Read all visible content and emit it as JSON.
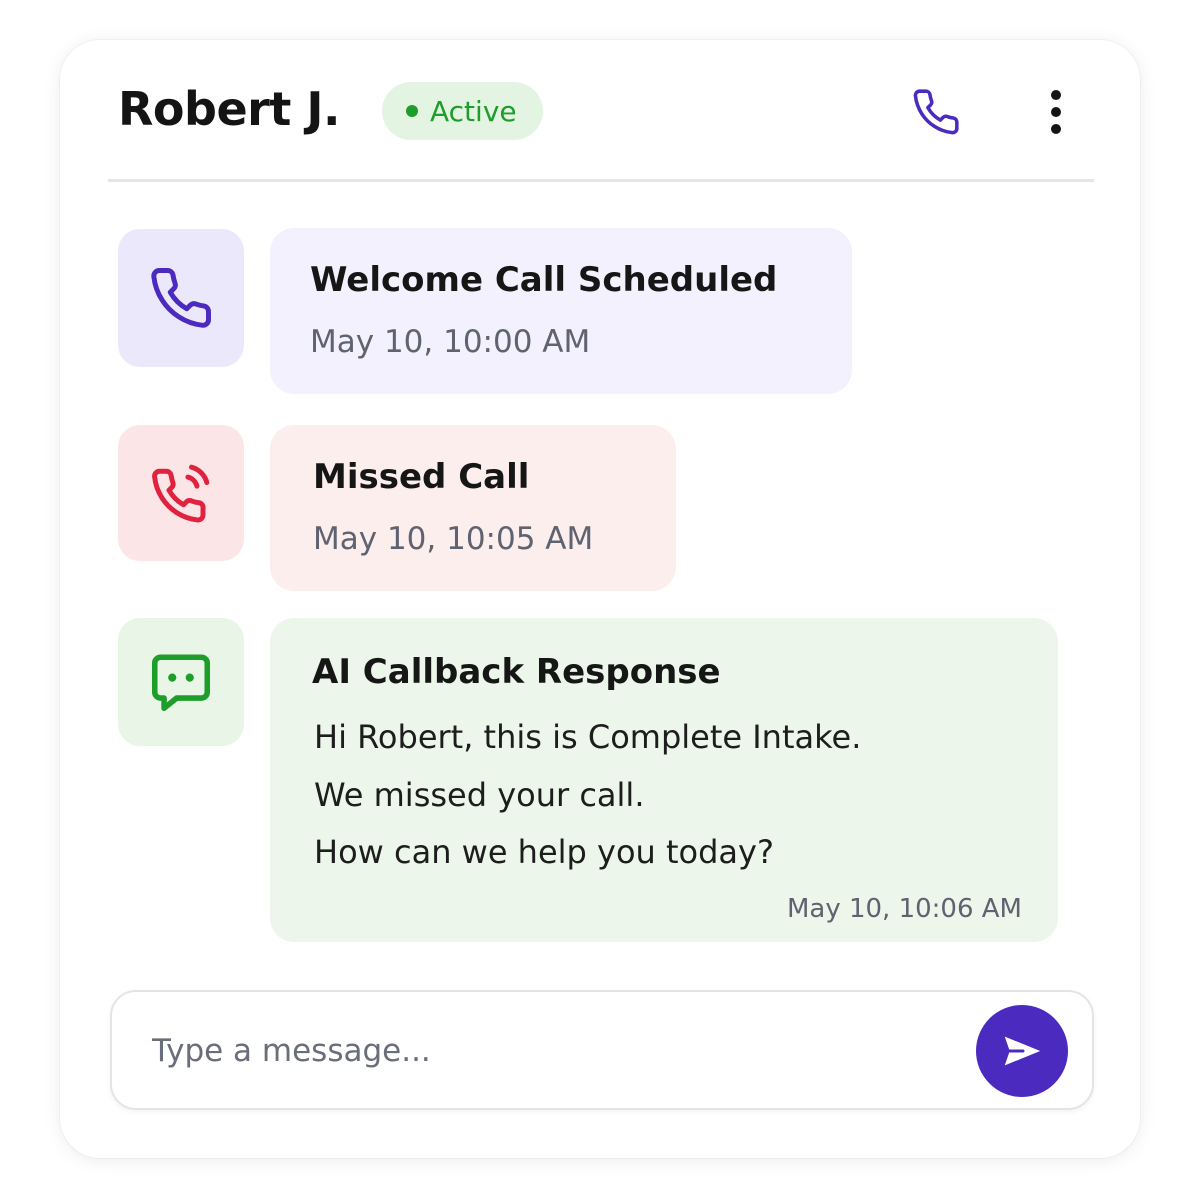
{
  "header": {
    "contact_name": "Robert J.",
    "status": "Active",
    "icons": {
      "call": "phone-icon",
      "more": "more-vertical-icon"
    }
  },
  "timeline": [
    {
      "type": "scheduled",
      "icon": "phone-icon",
      "title": "Welcome Call Scheduled",
      "time": "May 10, 10:00 AM"
    },
    {
      "type": "missed",
      "icon": "phone-ringing-icon",
      "title": "Missed Call",
      "time": "May 10, 10:05 AM"
    },
    {
      "type": "ai-response",
      "icon": "chat-bubble-icon",
      "title": "AI Callback Response",
      "lines": [
        "Hi Robert, this is Complete Intake.",
        "We missed your call.",
        "How can we help you today?"
      ],
      "time": "May 10, 10:06 AM"
    }
  ],
  "composer": {
    "placeholder": "Type a message...",
    "send_icon": "send-icon"
  },
  "colors": {
    "accent_purple": "#4b2bbf",
    "status_green": "#1f9d2a",
    "missed_red": "#e0223f",
    "scheduled_bg": "#f3f1fd",
    "missed_bg": "#fdeeee",
    "ai_bg": "#edf6ea"
  }
}
